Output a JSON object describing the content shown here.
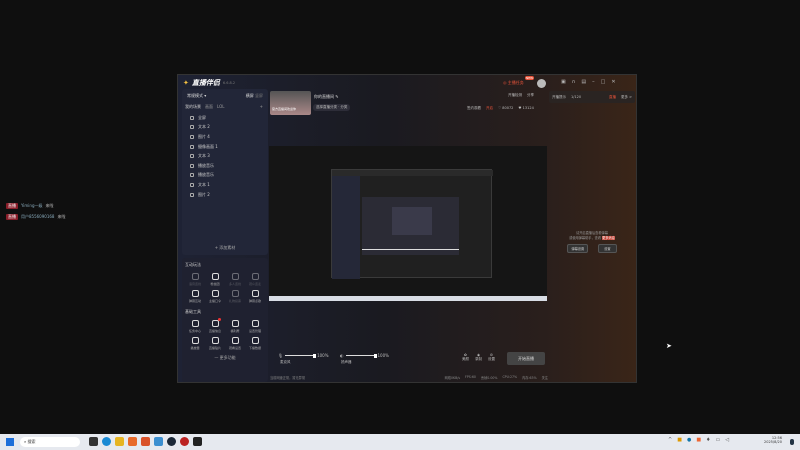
{
  "desktop": {
    "notifications": [
      {
        "tag": "直播",
        "user": "Yiming一级",
        "action": "来啦"
      },
      {
        "tag": "直播",
        "user": "用户8556090168",
        "action": "来啦"
      }
    ]
  },
  "app": {
    "title": "直播伴侣",
    "version": "6.6.8.2",
    "task_label": "主播任务",
    "task_badge": "NEW",
    "window_buttons": [
      "gift",
      "headset",
      "book",
      "minimize",
      "maximize",
      "close"
    ],
    "mode": "常规模式 ▾",
    "orientation_tabs": [
      "横屏",
      "竖屏"
    ],
    "scenes": {
      "label": "我的场景",
      "tabs": [
        "画面",
        "LOL"
      ],
      "add": "+",
      "items": [
        "全屏",
        "文本 2",
        "图片 4",
        "摄像画面 1",
        "文本 3",
        "播放音乐",
        "播放音乐",
        "文本 1",
        "图片 2"
      ],
      "add_source": "+ 添加素材"
    },
    "interactive": {
      "title": "互动玩法",
      "items": [
        {
          "label": "语音连线",
          "enabled": false
        },
        {
          "label": "粉丝团",
          "enabled": true
        },
        {
          "label": "多人连线",
          "enabled": false
        },
        {
          "label": "观众连麦",
          "enabled": false
        },
        {
          "label": "弹幕互动",
          "enabled": true
        },
        {
          "label": "主播口令",
          "enabled": true
        },
        {
          "label": "礼物投票",
          "enabled": false
        },
        {
          "label": "弹幕点歌",
          "enabled": true
        }
      ]
    },
    "tools": {
      "title": "基础工具",
      "items": [
        "任务中心",
        "直播信息",
        "福利屋",
        "设置管理",
        "播放器",
        "直播贴片",
        "观看设置",
        "下播数据"
      ],
      "more": "— 更多功能"
    },
    "stream": {
      "title": "你的直播间",
      "category": "选择直播分类 · 分类",
      "thumb_text": "官方直播间欢迎你"
    },
    "header_right": {
      "check": "开播检测",
      "share": "分享",
      "signed": "签约观看",
      "signed_state": "开启",
      "likes": "80072",
      "fans": "13124"
    },
    "chat_panel": {
      "tab1": "开播提示",
      "count": "1/120",
      "live": "直播",
      "more": "更多 >",
      "msg1": "请开启直播后查看弹幕",
      "msg2": "或使用弹幕助手，查看",
      "link": "更多消息",
      "btn1": "弹幕设置",
      "btn2": "设置"
    },
    "controls": {
      "mic_label": "麦克风",
      "mic_volume": "100%",
      "mic_value": 100,
      "spk_label": "扬声器",
      "spk_volume": "100%",
      "spk_value": 100,
      "beauty": "美颜",
      "record": "录制",
      "settings": "设置",
      "start": "开始直播"
    },
    "status": {
      "left": "当前网速正常，暂无异常",
      "items": [
        "网络0KB/s",
        "FPS:60",
        "丢帧0.00%",
        "CPU:27%",
        "内存:63%",
        "关注"
      ]
    }
  },
  "taskbar": {
    "search": "搜索",
    "time": "12:56",
    "date": "2025/8/20"
  }
}
